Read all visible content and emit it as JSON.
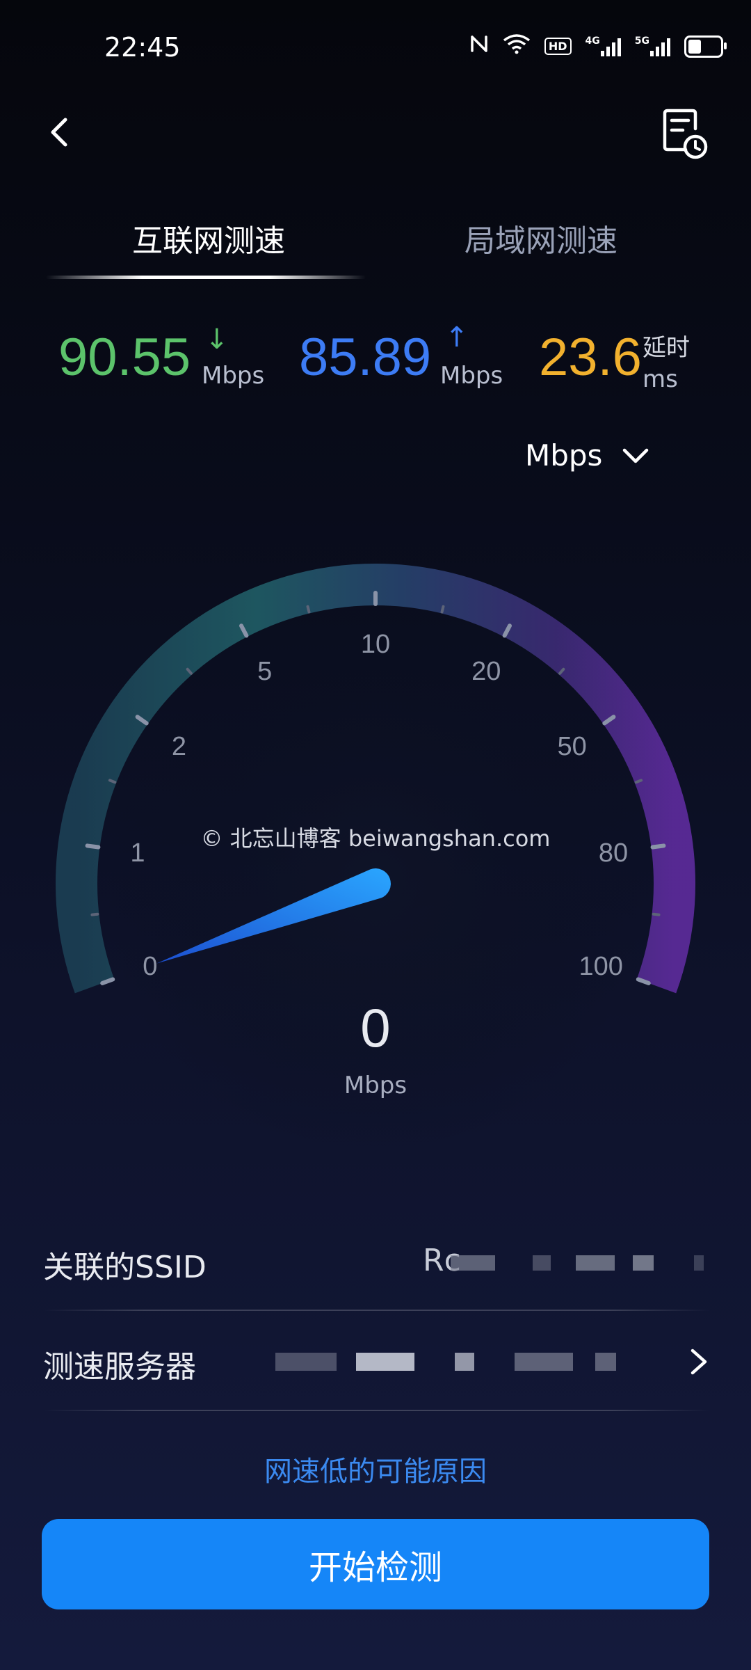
{
  "status_bar": {
    "time": "22:45",
    "icons": [
      "nfc-icon",
      "wifi-icon",
      "hd-icon",
      "signal-4g-icon",
      "signal-5g-icon",
      "battery-icon"
    ],
    "hd_label": "HD",
    "signal_4g_label": "4G",
    "signal_5g_label": "5G"
  },
  "header": {
    "back_icon": "chevron-left-icon",
    "history_icon": "document-clock-icon"
  },
  "tabs": [
    {
      "label": "互联网测速",
      "active": true
    },
    {
      "label": "局域网测速",
      "active": false
    }
  ],
  "metrics": {
    "download": {
      "value": "90.55",
      "unit": "Mbps",
      "arrow": "↓",
      "color": "#5cc36b"
    },
    "upload": {
      "value": "85.89",
      "unit": "Mbps",
      "arrow": "↑",
      "color": "#3d7cf5"
    },
    "latency": {
      "value": "23.6",
      "label": "延时",
      "unit": "ms",
      "color": "#f2b12e"
    }
  },
  "unit_selector": {
    "value": "Mbps"
  },
  "gauge": {
    "ticks": [
      "0",
      "1",
      "2",
      "5",
      "10",
      "20",
      "50",
      "80",
      "100"
    ],
    "current_value": "0",
    "unit": "Mbps",
    "watermark": "© 北忘山博客 beiwangshan.com"
  },
  "info": {
    "ssid_label": "关联的SSID",
    "ssid_value": "Rc",
    "server_label": "测速服务器"
  },
  "reasons_link": "网速低的可能原因",
  "start_button": "开始检测",
  "colors": {
    "accent": "#1586f8",
    "download": "#5cc36b",
    "upload": "#3d7cf5",
    "latency": "#f2b12e"
  }
}
